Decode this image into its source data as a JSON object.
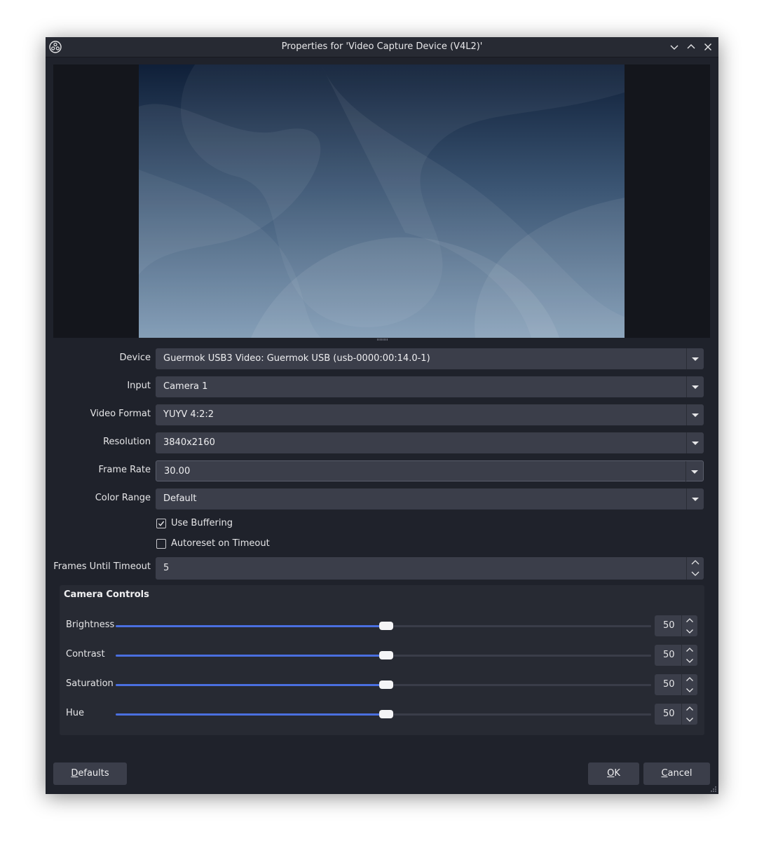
{
  "window": {
    "title": "Properties for 'Video Capture Device (V4L2)'"
  },
  "form": {
    "device": {
      "label": "Device",
      "value": "Guermok USB3 Video: Guermok USB (usb-0000:00:14.0-1)"
    },
    "input": {
      "label": "Input",
      "value": "Camera 1"
    },
    "video_format": {
      "label": "Video Format",
      "value": "YUYV 4:2:2"
    },
    "resolution": {
      "label": "Resolution",
      "value": "3840x2160"
    },
    "frame_rate": {
      "label": "Frame Rate",
      "value": "30.00"
    },
    "color_range": {
      "label": "Color Range",
      "value": "Default"
    },
    "use_buffering": {
      "label": "Use Buffering",
      "checked": true
    },
    "autoreset": {
      "label": "Autoreset on Timeout",
      "checked": false
    },
    "frames_until_timeout": {
      "label": "Frames Until Timeout",
      "value": "5"
    }
  },
  "camera_controls": {
    "title": "Camera Controls",
    "controls": [
      {
        "label": "Brightness",
        "value": "50",
        "level": 0.5
      },
      {
        "label": "Contrast",
        "value": "50",
        "level": 0.5
      },
      {
        "label": "Saturation",
        "value": "50",
        "level": 0.5
      },
      {
        "label": "Hue",
        "value": "50",
        "level": 0.5
      }
    ]
  },
  "buttons": {
    "defaults_mnemonic": "D",
    "defaults_rest": "efaults",
    "ok_mnemonic": "O",
    "ok_rest": "K",
    "cancel_mnemonic": "C",
    "cancel_rest": "ancel"
  },
  "icons": {
    "app": "obs-logo-icon",
    "minimize": "chevron-down-icon",
    "maximize": "chevron-up-icon",
    "close": "close-icon",
    "dropdown": "caret-down-icon"
  },
  "colors": {
    "window_bg": "#1f222b",
    "field_bg": "#3b3e4a",
    "accent": "#4a6fe0"
  }
}
